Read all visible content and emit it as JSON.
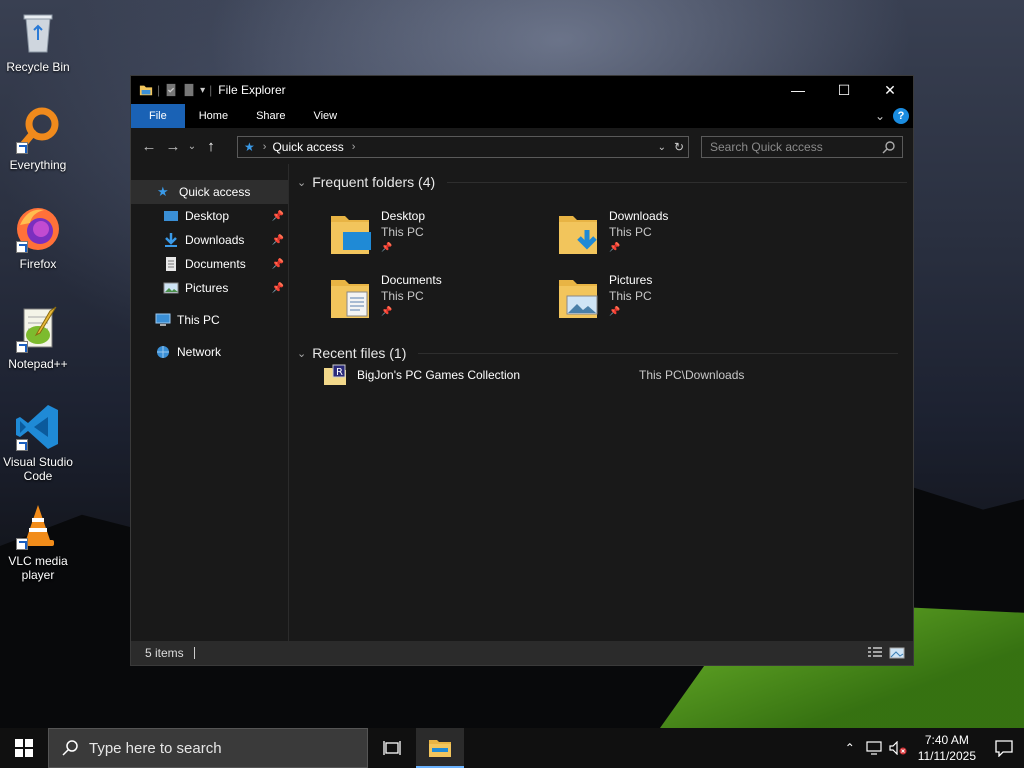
{
  "desktop": {
    "icons": [
      {
        "label": "Recycle Bin",
        "icon": "recycle-bin-icon"
      },
      {
        "label": "Everything",
        "icon": "everything-search-icon"
      },
      {
        "label": "Firefox",
        "icon": "firefox-icon"
      },
      {
        "label": "Notepad++",
        "icon": "notepad-plus-plus-icon"
      },
      {
        "label": "Visual Studio Code",
        "icon": "vscode-icon"
      },
      {
        "label": "VLC media player",
        "icon": "vlc-icon"
      }
    ]
  },
  "window": {
    "title": "File Explorer",
    "controls": {
      "minimize": "—",
      "maximize": "☐",
      "close": "✕"
    },
    "ribbon": {
      "tabs": [
        "File",
        "Home",
        "Share",
        "View"
      ],
      "help": "?"
    },
    "address": {
      "crumb": "Quick access"
    },
    "search": {
      "placeholder": "Search Quick access"
    },
    "nav": {
      "items": [
        {
          "label": "Quick access",
          "pinned": false
        },
        {
          "label": "Desktop",
          "pinned": true
        },
        {
          "label": "Downloads",
          "pinned": true
        },
        {
          "label": "Documents",
          "pinned": true
        },
        {
          "label": "Pictures",
          "pinned": true
        },
        {
          "label": "This PC",
          "pinned": false
        },
        {
          "label": "Network",
          "pinned": false
        }
      ]
    },
    "frequent": {
      "heading": "Frequent folders (4)",
      "folders": [
        {
          "name": "Desktop",
          "location": "This PC"
        },
        {
          "name": "Downloads",
          "location": "This PC"
        },
        {
          "name": "Documents",
          "location": "This PC"
        },
        {
          "name": "Pictures",
          "location": "This PC"
        }
      ]
    },
    "recent": {
      "heading": "Recent files (1)",
      "files": [
        {
          "name": "BigJon's PC Games Collection",
          "path": "This PC\\Downloads"
        }
      ]
    },
    "status": {
      "items": "5 items"
    }
  },
  "taskbar": {
    "search_placeholder": "Type here to search",
    "time": "7:40 AM",
    "date": "11/11/2025"
  },
  "colors": {
    "accent": "#1a62b5",
    "window_bg": "#191919",
    "folder": "#f2c55c"
  }
}
